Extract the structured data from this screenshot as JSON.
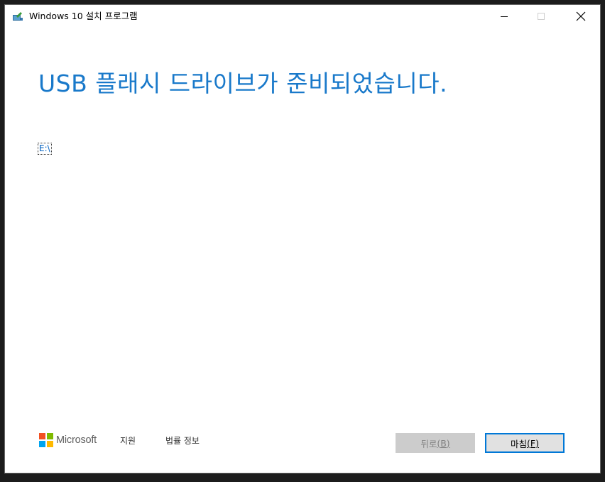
{
  "window": {
    "title": "Windows 10 설치 프로그램",
    "icon": "setup-app-icon"
  },
  "controls": {
    "minimize_icon": "minimize-icon",
    "maximize_icon": "maximize-icon",
    "close_icon": "close-icon"
  },
  "main": {
    "heading": "USB 플래시 드라이브가 준비되었습니다.",
    "drive_label": "E:\\"
  },
  "footer": {
    "brand": "Microsoft",
    "support_link": "지원",
    "legal_link": "법률 정보",
    "back_button": {
      "label": "뒤로",
      "accel": "(B)",
      "enabled": false
    },
    "finish_button": {
      "label": "마침",
      "accel": "(F)",
      "enabled": true
    }
  },
  "colors": {
    "heading_blue": "#1979ca",
    "accent_border": "#0078d7",
    "ms_red": "#f25022",
    "ms_green": "#7fba00",
    "ms_blue": "#00a4ef",
    "ms_yellow": "#ffb900"
  }
}
